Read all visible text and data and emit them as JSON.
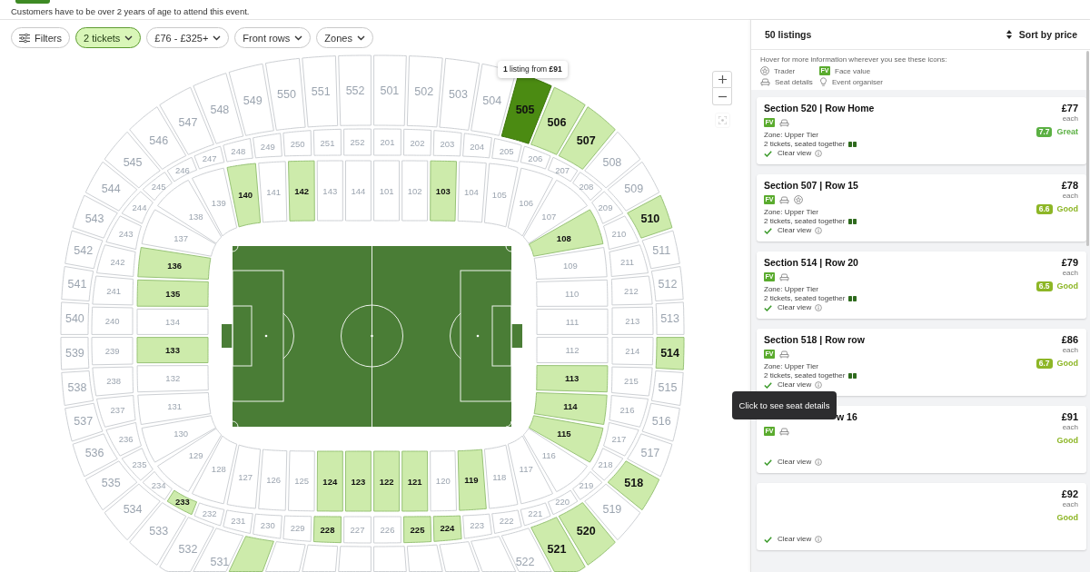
{
  "notice": {
    "text": "Customers have to be over 2 years of age to attend this event."
  },
  "filters": [
    {
      "kind": "filters",
      "label": "Filters",
      "active": false
    },
    {
      "kind": "dropdown",
      "label": "2 tickets",
      "active": true
    },
    {
      "kind": "dropdown",
      "label": "£76 - £325+",
      "active": false
    },
    {
      "kind": "dropdown",
      "label": "Front rows",
      "active": false
    },
    {
      "kind": "dropdown",
      "label": "Zones",
      "active": false
    }
  ],
  "seat_map": {
    "tooltip": "**1** listing from **£91**",
    "controls": [
      {
        "kind": "zoom_in",
        "disabled": false
      },
      {
        "kind": "zoom_out",
        "disabled": false
      },
      {
        "kind": "recenter",
        "disabled": true
      }
    ],
    "tiers": [
      {
        "kind": "upper",
        "arcs": [
          {
            "kind": "top",
            "sections": [
              {
                "label": "546",
                "available": false,
                "selected": false
              },
              {
                "label": "547",
                "available": false,
                "selected": false
              },
              {
                "label": "548",
                "available": false,
                "selected": false
              },
              {
                "label": "549",
                "available": false,
                "selected": false
              },
              {
                "label": "550",
                "available": false,
                "selected": false
              },
              {
                "label": "551",
                "available": false,
                "selected": false
              },
              {
                "label": "552",
                "available": false,
                "selected": false
              },
              {
                "label": "501",
                "available": false,
                "selected": false
              },
              {
                "label": "502",
                "available": false,
                "selected": false
              },
              {
                "label": "503",
                "available": false,
                "selected": false
              },
              {
                "label": "504",
                "available": false,
                "selected": false
              },
              {
                "label": "505",
                "available": true,
                "selected": true
              },
              {
                "label": "506",
                "available": true,
                "selected": false
              },
              {
                "label": "507",
                "available": true,
                "selected": false
              }
            ]
          },
          {
            "kind": "left",
            "sections": [
              {
                "label": "545",
                "available": false,
                "selected": false
              },
              {
                "label": "544",
                "available": false,
                "selected": false
              },
              {
                "label": "543",
                "available": false,
                "selected": false
              },
              {
                "label": "542",
                "available": false,
                "selected": false
              },
              {
                "label": "541",
                "available": false,
                "selected": false
              },
              {
                "label": "540",
                "available": false,
                "selected": false
              },
              {
                "label": "539",
                "available": false,
                "selected": false
              },
              {
                "label": "538",
                "available": false,
                "selected": false
              },
              {
                "label": "537",
                "available": false,
                "selected": false
              },
              {
                "label": "536",
                "available": false,
                "selected": false
              },
              {
                "label": "535",
                "available": false,
                "selected": false
              },
              {
                "label": "534",
                "available": false,
                "selected": false
              },
              {
                "label": "533",
                "available": false,
                "selected": false
              }
            ]
          },
          {
            "kind": "right",
            "sections": [
              {
                "label": "508",
                "available": false,
                "selected": false
              },
              {
                "label": "509",
                "available": false,
                "selected": false
              },
              {
                "label": "510",
                "available": true,
                "selected": false
              },
              {
                "label": "511",
                "available": false,
                "selected": false
              },
              {
                "label": "512",
                "available": false,
                "selected": false
              },
              {
                "label": "513",
                "available": false,
                "selected": false
              },
              {
                "label": "514",
                "available": true,
                "selected": false
              },
              {
                "label": "515",
                "available": false,
                "selected": false
              },
              {
                "label": "516",
                "available": false,
                "selected": false
              },
              {
                "label": "517",
                "available": false,
                "selected": false
              },
              {
                "label": "518",
                "available": true,
                "selected": false
              },
              {
                "label": "519",
                "available": false,
                "selected": false
              },
              {
                "label": "520",
                "available": true,
                "selected": false
              }
            ]
          },
          {
            "kind": "bottom",
            "sections": [
              {
                "label": "532",
                "available": false,
                "selected": false
              },
              {
                "label": "531",
                "available": false,
                "selected": false
              },
              {
                "available": true,
                "selected": false
              },
              {
                "available": false,
                "selected": false
              },
              {
                "available": false,
                "selected": false
              },
              {
                "available": false,
                "selected": false
              },
              {
                "available": false,
                "selected": false
              },
              {
                "available": false,
                "selected": false
              },
              {
                "available": false,
                "selected": false
              },
              {
                "available": false,
                "selected": false
              },
              {
                "label": "522",
                "available": false,
                "selected": false
              },
              {
                "label": "521",
                "available": true,
                "selected": false
              }
            ]
          }
        ]
      },
      {
        "kind": "middle",
        "arcs": [
          {
            "kind": "top",
            "sections": [
              {
                "label": "246",
                "available": false,
                "selected": false
              },
              {
                "label": "247",
                "available": false,
                "selected": false
              },
              {
                "label": "248",
                "available": false,
                "selected": false
              },
              {
                "label": "249",
                "available": false,
                "selected": false
              },
              {
                "label": "250",
                "available": false,
                "selected": false
              },
              {
                "label": "251",
                "available": false,
                "selected": false
              },
              {
                "label": "252",
                "available": false,
                "selected": false
              },
              {
                "label": "201",
                "available": false,
                "selected": false
              },
              {
                "label": "202",
                "available": false,
                "selected": false
              },
              {
                "label": "203",
                "available": false,
                "selected": false
              },
              {
                "label": "204",
                "available": false,
                "selected": false
              },
              {
                "label": "205",
                "available": false,
                "selected": false
              },
              {
                "label": "206",
                "available": false,
                "selected": false
              },
              {
                "label": "207",
                "available": false,
                "selected": false
              }
            ]
          },
          {
            "kind": "left",
            "sections": [
              {
                "label": "245",
                "available": false,
                "selected": false
              },
              {
                "label": "244",
                "available": false,
                "selected": false
              },
              {
                "label": "243",
                "available": false,
                "selected": false
              },
              {
                "label": "242",
                "available": false,
                "selected": false
              },
              {
                "label": "241",
                "available": false,
                "selected": false
              },
              {
                "label": "240",
                "available": false,
                "selected": false
              },
              {
                "label": "239",
                "available": false,
                "selected": false
              },
              {
                "label": "238",
                "available": false,
                "selected": false
              },
              {
                "label": "237",
                "available": false,
                "selected": false
              },
              {
                "label": "236",
                "available": false,
                "selected": false
              },
              {
                "label": "235",
                "available": false,
                "selected": false
              },
              {
                "label": "234",
                "available": false,
                "selected": false
              },
              {
                "label": "233",
                "available": true,
                "selected": false
              }
            ]
          },
          {
            "kind": "right",
            "sections": [
              {
                "label": "208",
                "available": false,
                "selected": false
              },
              {
                "label": "209",
                "available": false,
                "selected": false
              },
              {
                "label": "210",
                "available": false,
                "selected": false
              },
              {
                "label": "211",
                "available": false,
                "selected": false
              },
              {
                "label": "212",
                "available": false,
                "selected": false
              },
              {
                "label": "213",
                "available": false,
                "selected": false
              },
              {
                "label": "214",
                "available": false,
                "selected": false
              },
              {
                "label": "215",
                "available": false,
                "selected": false
              },
              {
                "label": "216",
                "available": false,
                "selected": false
              },
              {
                "label": "217",
                "available": false,
                "selected": false
              },
              {
                "label": "218",
                "available": false,
                "selected": false
              },
              {
                "label": "219",
                "available": false,
                "selected": false
              },
              {
                "label": "220",
                "available": false,
                "selected": false
              }
            ]
          },
          {
            "kind": "bottom",
            "sections": [
              {
                "label": "232",
                "available": false,
                "selected": false
              },
              {
                "label": "231",
                "available": false,
                "selected": false
              },
              {
                "label": "230",
                "available": false,
                "selected": false
              },
              {
                "label": "229",
                "available": false,
                "selected": false
              },
              {
                "label": "228",
                "available": true,
                "selected": false
              },
              {
                "label": "227",
                "available": false,
                "selected": false
              },
              {
                "label": "226",
                "available": false,
                "selected": false
              },
              {
                "label": "225",
                "available": true,
                "selected": false
              },
              {
                "label": "224",
                "available": true,
                "selected": false
              },
              {
                "label": "223",
                "available": false,
                "selected": false
              },
              {
                "label": "222",
                "available": false,
                "selected": false
              },
              {
                "label": "221",
                "available": false,
                "selected": false
              }
            ]
          }
        ]
      },
      {
        "kind": "lower",
        "arcs": [
          {
            "kind": "top",
            "sections": [
              {
                "label": "139",
                "available": false,
                "selected": false
              },
              {
                "label": "140",
                "available": true,
                "selected": false
              },
              {
                "label": "141",
                "available": false,
                "selected": false
              },
              {
                "label": "142",
                "available": true,
                "selected": false
              },
              {
                "label": "143",
                "available": false,
                "selected": false
              },
              {
                "label": "144",
                "available": false,
                "selected": false
              },
              {
                "label": "101",
                "available": false,
                "selected": false
              },
              {
                "label": "102",
                "available": false,
                "selected": false
              },
              {
                "label": "103",
                "available": true,
                "selected": false
              },
              {
                "label": "104",
                "available": false,
                "selected": false
              },
              {
                "label": "105",
                "available": false,
                "selected": false
              },
              {
                "label": "106",
                "available": false,
                "selected": false
              }
            ]
          },
          {
            "kind": "left",
            "sections": [
              {
                "label": "138",
                "available": false,
                "selected": false
              },
              {
                "label": "137",
                "available": false,
                "selected": false
              },
              {
                "label": "136",
                "available": true,
                "selected": false
              },
              {
                "label": "135",
                "available": true,
                "selected": false
              },
              {
                "label": "134",
                "available": false,
                "selected": false
              },
              {
                "label": "133",
                "available": true,
                "selected": false
              },
              {
                "label": "132",
                "available": false,
                "selected": false
              },
              {
                "label": "131",
                "available": false,
                "selected": false
              },
              {
                "label": "130",
                "available": false,
                "selected": false
              },
              {
                "label": "129",
                "available": false,
                "selected": false
              }
            ]
          },
          {
            "kind": "right",
            "sections": [
              {
                "label": "107",
                "available": false,
                "selected": false
              },
              {
                "label": "108",
                "available": true,
                "selected": false
              },
              {
                "label": "109",
                "available": false,
                "selected": false
              },
              {
                "label": "110",
                "available": false,
                "selected": false
              },
              {
                "label": "111",
                "available": false,
                "selected": false
              },
              {
                "label": "112",
                "available": false,
                "selected": false
              },
              {
                "label": "113",
                "available": true,
                "selected": false
              },
              {
                "label": "114",
                "available": true,
                "selected": false
              },
              {
                "label": "115",
                "available": true,
                "selected": false
              },
              {
                "label": "116",
                "available": false,
                "selected": false
              }
            ]
          },
          {
            "kind": "bottom",
            "sections": [
              {
                "label": "128",
                "available": false,
                "selected": false
              },
              {
                "label": "127",
                "available": false,
                "selected": false
              },
              {
                "label": "126",
                "available": false,
                "selected": false
              },
              {
                "label": "125",
                "available": false,
                "selected": false
              },
              {
                "label": "124",
                "available": true,
                "selected": false
              },
              {
                "label": "123",
                "available": true,
                "selected": false
              },
              {
                "label": "122",
                "available": true,
                "selected": false
              },
              {
                "label": "121",
                "available": true,
                "selected": false
              },
              {
                "label": "120",
                "available": false,
                "selected": false
              },
              {
                "label": "119",
                "available": true,
                "selected": false
              },
              {
                "label": "118",
                "available": false,
                "selected": false
              },
              {
                "label": "117",
                "available": false,
                "selected": false
              }
            ]
          }
        ]
      }
    ]
  },
  "listings": {
    "count": "50 listings",
    "sort": "Sort by price",
    "legend": {
      "hint": "Hover for more information wherever you see these icons:",
      "items": [
        {
          "kind": "trader",
          "label": "Trader"
        },
        {
          "kind": "face_value",
          "badge": "FV",
          "label": "Face value"
        },
        {
          "kind": "seat_details",
          "label": "Seat details"
        },
        {
          "kind": "event_organiser",
          "label": "Event organiser"
        }
      ]
    },
    "cards": [
      {
        "title": "Section 520 | Row Home",
        "features": [
          {
            "kind": "face_value",
            "text": "FV"
          },
          {
            "kind": "seat_details"
          }
        ],
        "zone": "Zone: Upper Tier",
        "tickets": "2 tickets, seated together",
        "view": "Clear view",
        "price": "£77",
        "per": "each",
        "rating": {
          "score": "7.7",
          "label": "Great",
          "color": "#5bb043"
        }
      },
      {
        "title": "Section 507 | Row 15",
        "features": [
          {
            "kind": "face_value",
            "text": "FV"
          },
          {
            "kind": "seat_details"
          },
          {
            "kind": "trader"
          }
        ],
        "zone": "Zone: Upper Tier",
        "tickets": "2 tickets, seated together",
        "view": "Clear view",
        "price": "£78",
        "per": "each",
        "rating": {
          "score": "6.6",
          "label": "Good",
          "color": "#8db626"
        }
      },
      {
        "title": "Section 514 | Row 20",
        "features": [
          {
            "kind": "face_value",
            "text": "FV"
          },
          {
            "kind": "seat_details"
          }
        ],
        "zone": "Zone: Upper Tier",
        "tickets": "2 tickets, seated together",
        "view": "Clear view",
        "price": "£79",
        "per": "each",
        "rating": {
          "score": "6.5",
          "label": "Good",
          "color": "#8db626"
        }
      },
      {
        "title": "Section 518 | Row row",
        "features": [
          {
            "kind": "face_value",
            "text": "FV"
          },
          {
            "kind": "seat_details"
          }
        ],
        "zone": "Zone: Upper Tier",
        "tickets": "2 tickets, seated together",
        "view": "Clear view",
        "price": "£86",
        "per": "each",
        "rating": {
          "score": "6.7",
          "label": "Good",
          "color": "#8db626"
        }
      },
      {
        "title": "w 16",
        "tooltip": "Click to see seat details",
        "features": [
          {
            "kind": "face_value",
            "text": "FV"
          },
          {
            "kind": "seat_details"
          }
        ],
        "view": "Clear view",
        "price": "£91",
        "per": "each",
        "rating": {
          "label": "Good",
          "color": "#8db626"
        }
      },
      {
        "view": "Clear view",
        "price": "£92",
        "per": "each",
        "rating": {
          "label": "Good",
          "color": "#8db626"
        }
      }
    ]
  }
}
